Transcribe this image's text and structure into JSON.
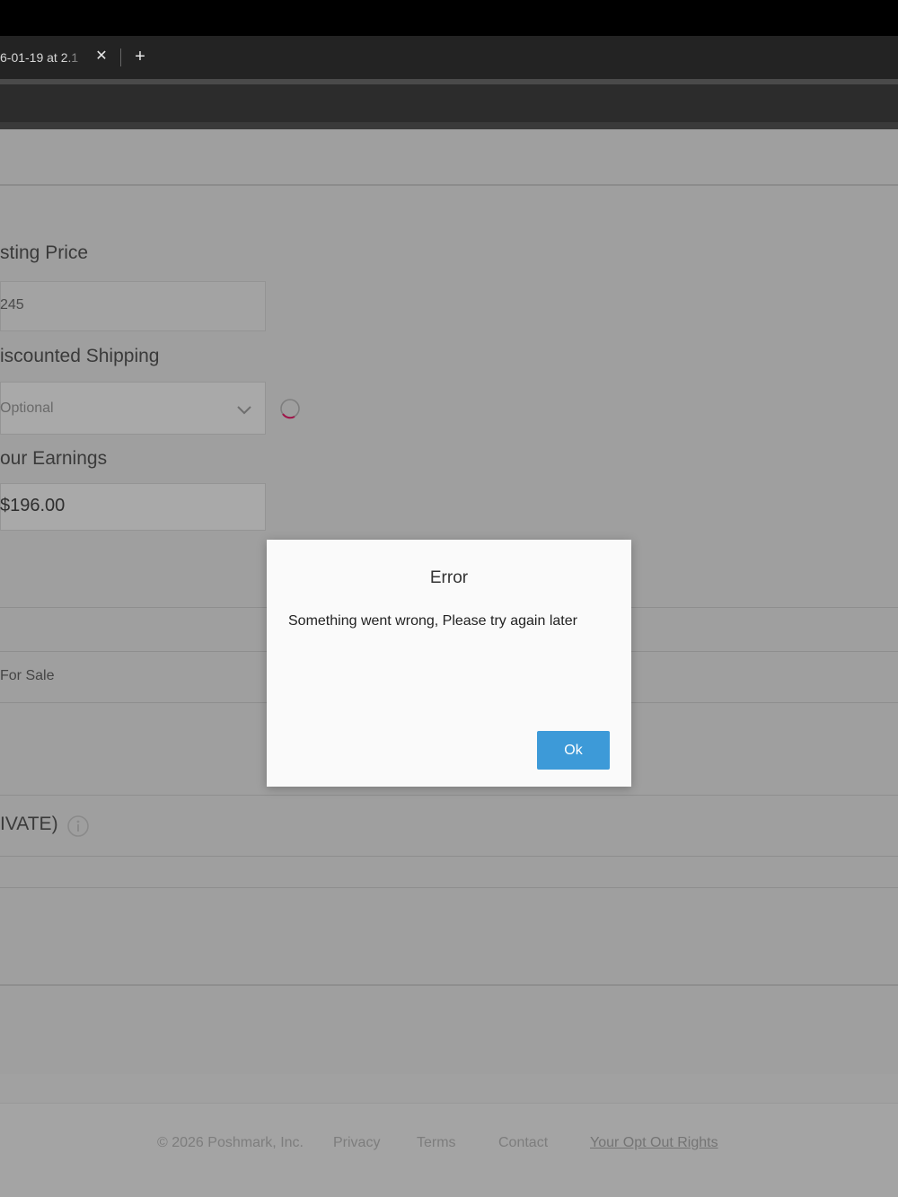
{
  "browser": {
    "tab_title": "6-01-19 at 2.1",
    "close_glyph": "✕",
    "new_tab_glyph": "+"
  },
  "form": {
    "listing_price_label": "sting Price",
    "listing_price_value": "245",
    "discounted_shipping_label": "iscounted Shipping",
    "discounted_shipping_placeholder": "Optional",
    "earnings_label": "our Earnings",
    "earnings_value": "$196.00",
    "for_sale_label": "For Sale",
    "private_label": "IVATE)"
  },
  "footer": {
    "copyright": "© 2026 Poshmark, Inc.",
    "privacy": "Privacy",
    "terms": "Terms",
    "contact": "Contact",
    "opt_out": "Your Opt Out Rights"
  },
  "modal": {
    "title": "Error",
    "message": "Something went wrong, Please try again later",
    "ok_label": "Ok"
  },
  "colors": {
    "ok_button": "#3d9ad8",
    "spinner_accent": "#a0154a"
  },
  "icons": [
    "close-icon",
    "plus-icon",
    "chevron-down-icon",
    "loading-spinner-icon",
    "info-icon"
  ]
}
